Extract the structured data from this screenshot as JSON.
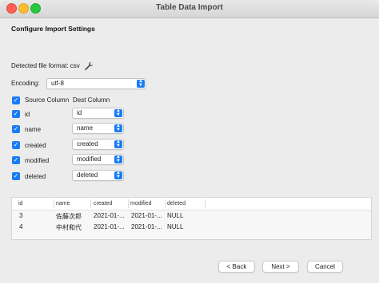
{
  "window": {
    "title": "Table Data Import"
  },
  "heading": "Configure Import Settings",
  "detected_format": "Detected file format: csv",
  "encoding": {
    "label": "Encoding:",
    "value": "utf-8"
  },
  "mapping": {
    "source_header": "Source Column",
    "dest_header": "Dest Column",
    "rows": [
      {
        "source": "id",
        "dest": "id"
      },
      {
        "source": "name",
        "dest": "name"
      },
      {
        "source": "created",
        "dest": "created"
      },
      {
        "source": "modified",
        "dest": "modified"
      },
      {
        "source": "deleted",
        "dest": "deleted"
      }
    ]
  },
  "preview": {
    "headers": [
      "id",
      "name",
      "created",
      "modified",
      "deleted"
    ],
    "rows": [
      [
        "3",
        "佐藤次郎",
        "2021-01-...",
        "2021-01-...",
        "NULL"
      ],
      [
        "4",
        "中村和代",
        "2021-01-...",
        "2021-01-...",
        "NULL"
      ]
    ]
  },
  "buttons": {
    "back": "< Back",
    "next": "Next >",
    "cancel": "Cancel"
  }
}
